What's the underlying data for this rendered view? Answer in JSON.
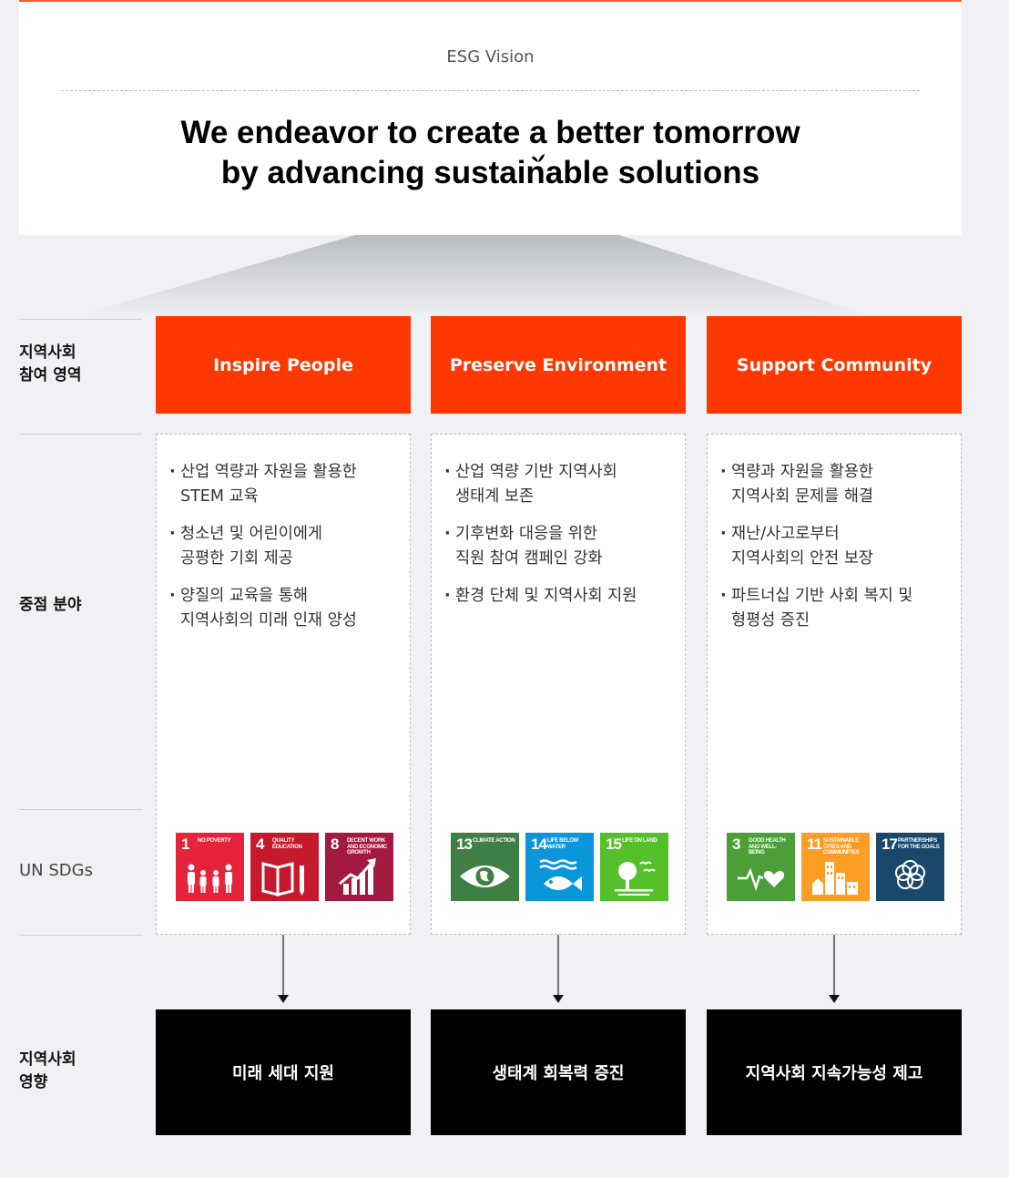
{
  "vision": {
    "label": "ESG Vision",
    "statement_line1": "We endeavor to create a better tomorrow",
    "statement_line2": "by advancing sustainable solutions"
  },
  "row_labels": {
    "areas": "지역사회\n참여 영역",
    "focus": "중점 분야",
    "sdgs": "UN SDGs",
    "impact": "지역사회\n영향"
  },
  "columns": [
    {
      "area": "Inspire People",
      "focus_items": [
        "산업 역량과 자원을 활용한\nSTEM 교육",
        "청소년 및 어린이에게\n공평한 기회 제공",
        "양질의 교육을 통해\n지역사회의 미래 인재 양성"
      ],
      "sdgs": [
        {
          "number": "1",
          "title": "No Poverty",
          "color": "#e5243b",
          "icon": "family-icon"
        },
        {
          "number": "4",
          "title": "Quality Education",
          "color": "#c5192d",
          "icon": "book-pencil-icon"
        },
        {
          "number": "8",
          "title": "Decent Work and Economic Growth",
          "color": "#a21942",
          "icon": "growth-chart-icon"
        }
      ],
      "impact": "미래 세대 지원"
    },
    {
      "area": "Preserve Environment",
      "focus_items": [
        "산업 역량 기반 지역사회\n생태계 보존",
        "기후변화 대응을 위한\n직원 참여 캠페인 강화",
        "환경 단체 및 지역사회 지원"
      ],
      "sdgs": [
        {
          "number": "13",
          "title": "Climate Action",
          "color": "#3f7e44",
          "icon": "eye-globe-icon"
        },
        {
          "number": "14",
          "title": "Life Below Water",
          "color": "#0a97d9",
          "icon": "fish-icon"
        },
        {
          "number": "15",
          "title": "Life On Land",
          "color": "#56c02b",
          "icon": "tree-icon"
        }
      ],
      "impact": "생태계 회복력 증진"
    },
    {
      "area": "Support Community",
      "focus_items": [
        "역량과 자원을 활용한\n지역사회 문제를 해결",
        "재난/사고로부터\n지역사회의 안전 보장",
        "파트너십 기반 사회 복지 및\n형평성 증진"
      ],
      "sdgs": [
        {
          "number": "3",
          "title": "Good Health and Well-Being",
          "color": "#4c9f38",
          "icon": "heartbeat-icon"
        },
        {
          "number": "11",
          "title": "Sustainable Cities and Communities",
          "color": "#fd9d24",
          "icon": "city-icon"
        },
        {
          "number": "17",
          "title": "Partnerships for the Goals",
          "color": "#19486a",
          "icon": "rings-icon"
        }
      ],
      "impact": "지역사회 지속가능성 제고"
    }
  ]
}
